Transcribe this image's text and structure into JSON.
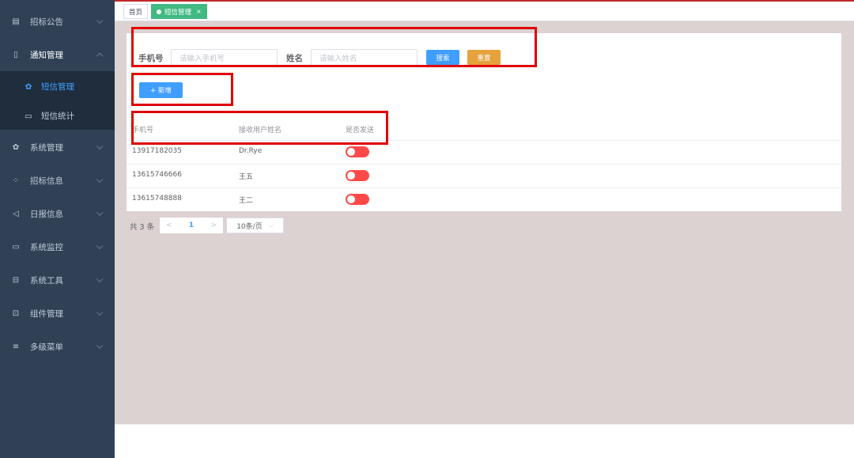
{
  "sidebar": {
    "items": [
      {
        "label": "招标公告",
        "icon": "doc-icon"
      },
      {
        "label": "通知管理",
        "icon": "phone-icon"
      },
      {
        "label": "系统管理",
        "icon": "gear-icon"
      },
      {
        "label": "招标信息",
        "icon": "grid-icon"
      },
      {
        "label": "日报信息",
        "icon": "send-icon"
      },
      {
        "label": "系统监控",
        "icon": "monitor-icon"
      },
      {
        "label": "系统工具",
        "icon": "toolbox-icon"
      },
      {
        "label": "组件管理",
        "icon": "component-icon"
      },
      {
        "label": "多级菜单",
        "icon": "menu-icon"
      }
    ],
    "subitems": [
      {
        "label": "短信管理",
        "icon": "gear-icon",
        "active": true
      },
      {
        "label": "短信统计",
        "icon": "monitor-icon",
        "active": false
      }
    ]
  },
  "tags": {
    "home": "首页",
    "current": "短信管理",
    "close": "×"
  },
  "search": {
    "phone_label": "手机号",
    "phone_placeholder": "请输入手机号",
    "name_label": "姓名",
    "name_placeholder": "请输入姓名",
    "search_button": "搜索",
    "reset_button": "重置"
  },
  "toolbar": {
    "add_button": "+ 新增"
  },
  "table": {
    "columns": [
      "手机号",
      "接收用户姓名",
      "是否发送"
    ],
    "rows": [
      {
        "phone": "13917182035",
        "name": "Dr.Rye",
        "send": false
      },
      {
        "phone": "13615746666",
        "name": "王五",
        "send": false
      },
      {
        "phone": "13615748888",
        "name": "王二",
        "send": false
      }
    ]
  },
  "pagination": {
    "total": "共 3 条",
    "prev": "<",
    "page": "1",
    "next": ">",
    "page_size": "10条/页"
  },
  "colors": {
    "sidebar_bg": "#304156",
    "primary": "#409eff",
    "warning": "#e6a23c",
    "switch_off": "#ff4949",
    "annotation": "#e00000"
  }
}
